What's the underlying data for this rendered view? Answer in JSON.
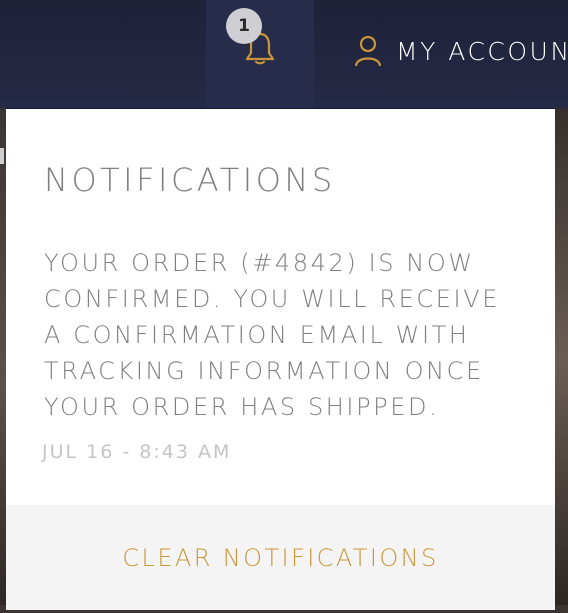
{
  "header": {
    "notification_badge": "1",
    "notification_icon": "bell-icon",
    "account_icon": "user-icon",
    "account_label": "MY ACCOUN",
    "accent_color": "#c9973a"
  },
  "notifications_panel": {
    "title": "NOTIFICATIONS",
    "items": [
      {
        "message": "YOUR ORDER (#4842) IS NOW CONFIRMED. YOU WILL RECEIVE A CONFIRMATION EMAIL WITH TRACKING INFORMATION ONCE YOUR ORDER HAS SHIPPED.",
        "timestamp": "JUL 16 - 8:43 AM"
      }
    ],
    "clear_label": "CLEAR NOTIFICATIONS"
  }
}
